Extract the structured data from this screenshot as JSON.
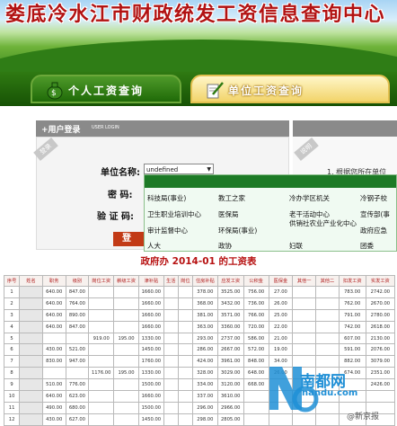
{
  "banner": {
    "title": "娄底冷水江市财政统发工资信息查询中心"
  },
  "nav": {
    "tabs": [
      {
        "label": "个人工资查询"
      },
      {
        "label": "单位工资查询"
      }
    ]
  },
  "login": {
    "title": "+用户登录",
    "subtitle": "USER LOGIN",
    "corner_tag": "登录",
    "unit_label": "单位名称:",
    "unit_value": "undefined",
    "password_label": "密 码:",
    "captcha_label": "验 证 码:",
    "button_label": "登"
  },
  "right_panel": {
    "corner_tag": "说明",
    "text": "1. 根据您所在单位"
  },
  "dropdown": {
    "items": [
      [
        "科技局(事业)",
        "教工之家",
        "冷办学区机关",
        "冷钢子校"
      ],
      [
        "卫生职业培训中心",
        "医保局",
        "老干活动中心",
        "宣传部(事"
      ],
      [
        "审计监督中心",
        "环保局(事业)",
        "供销社农业产业化中心",
        "政府应急"
      ],
      [
        "人大",
        "政协",
        "妇联",
        "团委"
      ]
    ]
  },
  "sheet": {
    "title": "政府办 2014-01 的工资表",
    "columns": [
      "序号",
      "姓名",
      "职务",
      "级别",
      "岗位工资",
      "薪级工资",
      "津补贴",
      "生活",
      "岗位",
      "住房补贴",
      "应发工资",
      "公积金",
      "医保金",
      "其他一",
      "其他二",
      "扣发工资",
      "实发工资"
    ],
    "rows": [
      [
        "1",
        "",
        "640.00",
        "847.00",
        "",
        "",
        "1660.00",
        "",
        "",
        "378.00",
        "3525.00",
        "756.00",
        "27.00",
        "",
        "",
        "783.00",
        "2742.00"
      ],
      [
        "2",
        "",
        "640.00",
        "764.00",
        "",
        "",
        "1660.00",
        "",
        "",
        "368.00",
        "3432.00",
        "736.00",
        "26.00",
        "",
        "",
        "762.00",
        "2670.00"
      ],
      [
        "3",
        "",
        "640.00",
        "890.00",
        "",
        "",
        "1660.00",
        "",
        "",
        "381.00",
        "3571.00",
        "766.00",
        "25.00",
        "",
        "",
        "791.00",
        "2780.00"
      ],
      [
        "4",
        "",
        "640.00",
        "847.00",
        "",
        "",
        "1660.00",
        "",
        "",
        "363.00",
        "3360.00",
        "720.00",
        "22.00",
        "",
        "",
        "742.00",
        "2618.00"
      ],
      [
        "5",
        "",
        "",
        "",
        "919.00",
        "195.00",
        "1330.00",
        "",
        "",
        "293.00",
        "2737.00",
        "586.00",
        "21.00",
        "",
        "",
        "607.00",
        "2130.00"
      ],
      [
        "6",
        "",
        "430.00",
        "521.00",
        "",
        "",
        "1450.00",
        "",
        "",
        "286.00",
        "2667.00",
        "572.00",
        "19.00",
        "",
        "",
        "591.00",
        "2076.00"
      ],
      [
        "7",
        "",
        "830.00",
        "947.00",
        "",
        "",
        "1760.00",
        "",
        "",
        "424.00",
        "3961.00",
        "848.00",
        "34.00",
        "",
        "",
        "882.00",
        "3079.00"
      ],
      [
        "8",
        "",
        "",
        "",
        "1176.00",
        "195.00",
        "1330.00",
        "",
        "",
        "328.00",
        "3029.00",
        "648.00",
        "26.00",
        "",
        "",
        "674.00",
        "2351.00"
      ],
      [
        "9",
        "",
        "510.00",
        "776.00",
        "",
        "",
        "1500.00",
        "",
        "",
        "334.00",
        "3120.00",
        "668.00",
        "",
        "",
        "",
        "",
        "2426.00"
      ],
      [
        "10",
        "",
        "640.00",
        "623.00",
        "",
        "",
        "1660.00",
        "",
        "",
        "337.00",
        "3610.00",
        "",
        "",
        "",
        "",
        "",
        ""
      ],
      [
        "11",
        "",
        "490.00",
        "680.00",
        "",
        "",
        "1500.00",
        "",
        "",
        "296.00",
        "2966.00",
        "",
        "",
        "",
        "",
        "",
        ""
      ],
      [
        "12",
        "",
        "430.00",
        "627.00",
        "",
        "",
        "1450.00",
        "",
        "",
        "298.00",
        "2805.00",
        "",
        "",
        "",
        "",
        "",
        ""
      ]
    ]
  },
  "watermark": {
    "logo_letter": "N",
    "name": "南都网",
    "url": "nandu.com",
    "source": "@新京报"
  },
  "colors": {
    "title_red": "#b21212",
    "nav_green": "#1f6a08",
    "dropdown_green": "#1d7a26",
    "watermark_blue": "#1f8fd6"
  }
}
